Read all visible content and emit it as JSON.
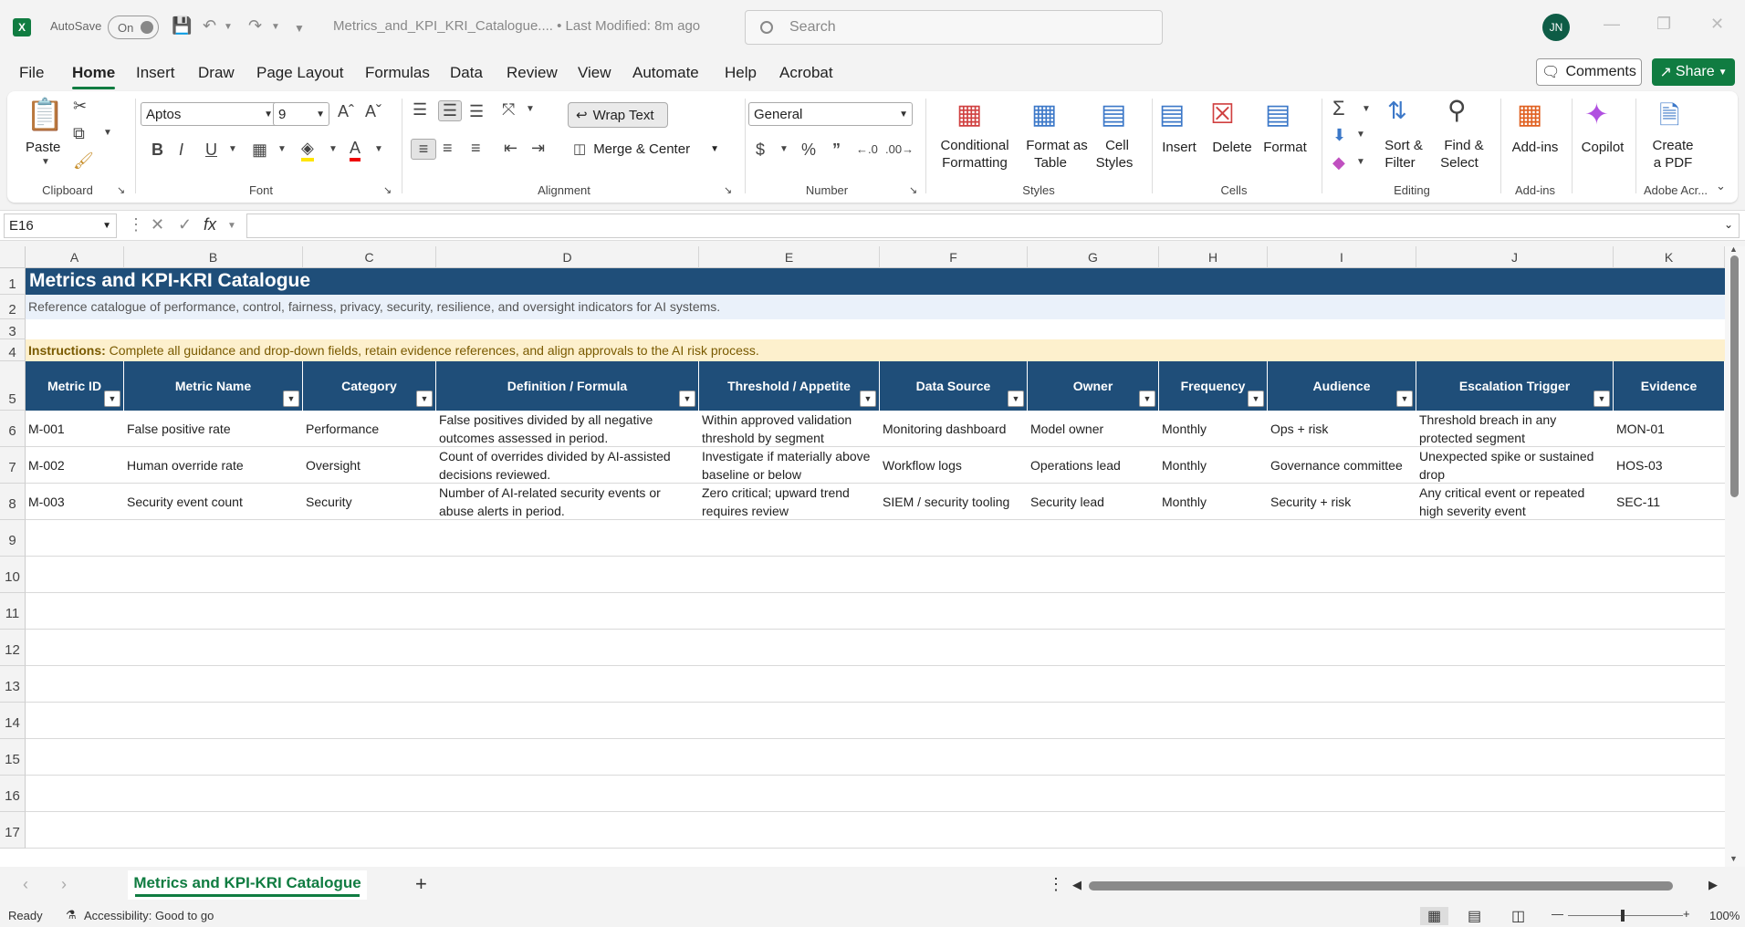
{
  "title_bar": {
    "app_badge": "X",
    "autosave_label": "AutoSave",
    "autosave_state": "On",
    "doc_title": "Metrics_and_KPI_KRI_Catalogue.... • Last Modified: 8m ago",
    "search_placeholder": "Search",
    "user_initials": "JN"
  },
  "menu": {
    "tabs": [
      "File",
      "Home",
      "Insert",
      "Draw",
      "Page Layout",
      "Formulas",
      "Data",
      "Review",
      "View",
      "Automate",
      "Help",
      "Acrobat"
    ],
    "active": "Home",
    "comments_label": "Comments",
    "share_label": "Share"
  },
  "ribbon": {
    "clipboard": {
      "label": "Clipboard",
      "paste": "Paste"
    },
    "font": {
      "label": "Font",
      "name": "Aptos",
      "size": "9"
    },
    "alignment": {
      "label": "Alignment",
      "wrap_text": "Wrap Text",
      "merge_center": "Merge & Center"
    },
    "number": {
      "label": "Number",
      "format": "General"
    },
    "styles": {
      "label": "Styles",
      "conditional": "Conditional",
      "formatting": "Formatting",
      "format_as": "Format as",
      "table": "Table",
      "cell": "Cell",
      "cell_styles": "Styles"
    },
    "cells": {
      "label": "Cells",
      "insert": "Insert",
      "delete": "Delete",
      "format": "Format"
    },
    "editing": {
      "label": "Editing",
      "sort": "Sort &",
      "filter": "Filter",
      "find": "Find &",
      "select": "Select"
    },
    "addins": {
      "label": "Add-ins",
      "addins": "Add-ins"
    },
    "copilot": {
      "label": "Copilot"
    },
    "adobe": {
      "label": "Adobe Acr...",
      "create": "Create",
      "pdf": "a PDF"
    }
  },
  "formula_bar": {
    "name_box": "E16",
    "formula": ""
  },
  "columns": [
    "A",
    "B",
    "C",
    "D",
    "E",
    "F",
    "G",
    "H",
    "I",
    "J",
    "K"
  ],
  "rows": [
    "1",
    "2",
    "3",
    "4",
    "5",
    "6",
    "7",
    "8",
    "9",
    "10",
    "11",
    "12",
    "13",
    "14",
    "15",
    "16",
    "17"
  ],
  "sheet": {
    "title": "Metrics and KPI-KRI Catalogue",
    "subtitle": "Reference catalogue of performance, control, fairness, privacy, security, resilience, and oversight indicators for AI systems.",
    "instructions_label": "Instructions:",
    "instructions_text": " Complete all guidance and drop-down fields, retain evidence references, and align approvals to the AI risk process.",
    "headers": [
      "Metric ID",
      "Metric Name",
      "Category",
      "Definition / Formula",
      "Threshold / Appetite",
      "Data Source",
      "Owner",
      "Frequency",
      "Audience",
      "Escalation Trigger",
      "Evidence"
    ],
    "data_rows": [
      [
        "M-001",
        "False positive rate",
        "Performance",
        "False positives divided by all negative outcomes assessed in period.",
        "Within approved validation threshold by segment",
        "Monitoring dashboard",
        "Model owner",
        "Monthly",
        "Ops + risk",
        "Threshold breach in any protected segment",
        "MON-01"
      ],
      [
        "M-002",
        "Human override rate",
        "Oversight",
        "Count of overrides divided by AI-assisted decisions reviewed.",
        "Investigate if materially above baseline or below",
        "Workflow logs",
        "Operations lead",
        "Monthly",
        "Governance committee",
        "Unexpected spike or sustained drop",
        "HOS-03"
      ],
      [
        "M-003",
        "Security event count",
        "Security",
        "Number of AI-related security events or abuse alerts in period.",
        "Zero critical; upward trend requires review",
        "SIEM / security tooling",
        "Security lead",
        "Monthly",
        "Security + risk",
        "Any critical event or repeated high severity event",
        "SEC-11"
      ]
    ]
  },
  "sheet_tabs": {
    "active": "Metrics and KPI-KRI Catalogue",
    "add": "+"
  },
  "status": {
    "ready": "Ready",
    "accessibility": "Accessibility: Good to go",
    "zoom": "100%"
  },
  "colors": {
    "accent": "#107c41",
    "header_fill": "#1f4e79",
    "instr_fill": "#fdf0cd",
    "subtitle_fill": "#eaf1fa"
  }
}
